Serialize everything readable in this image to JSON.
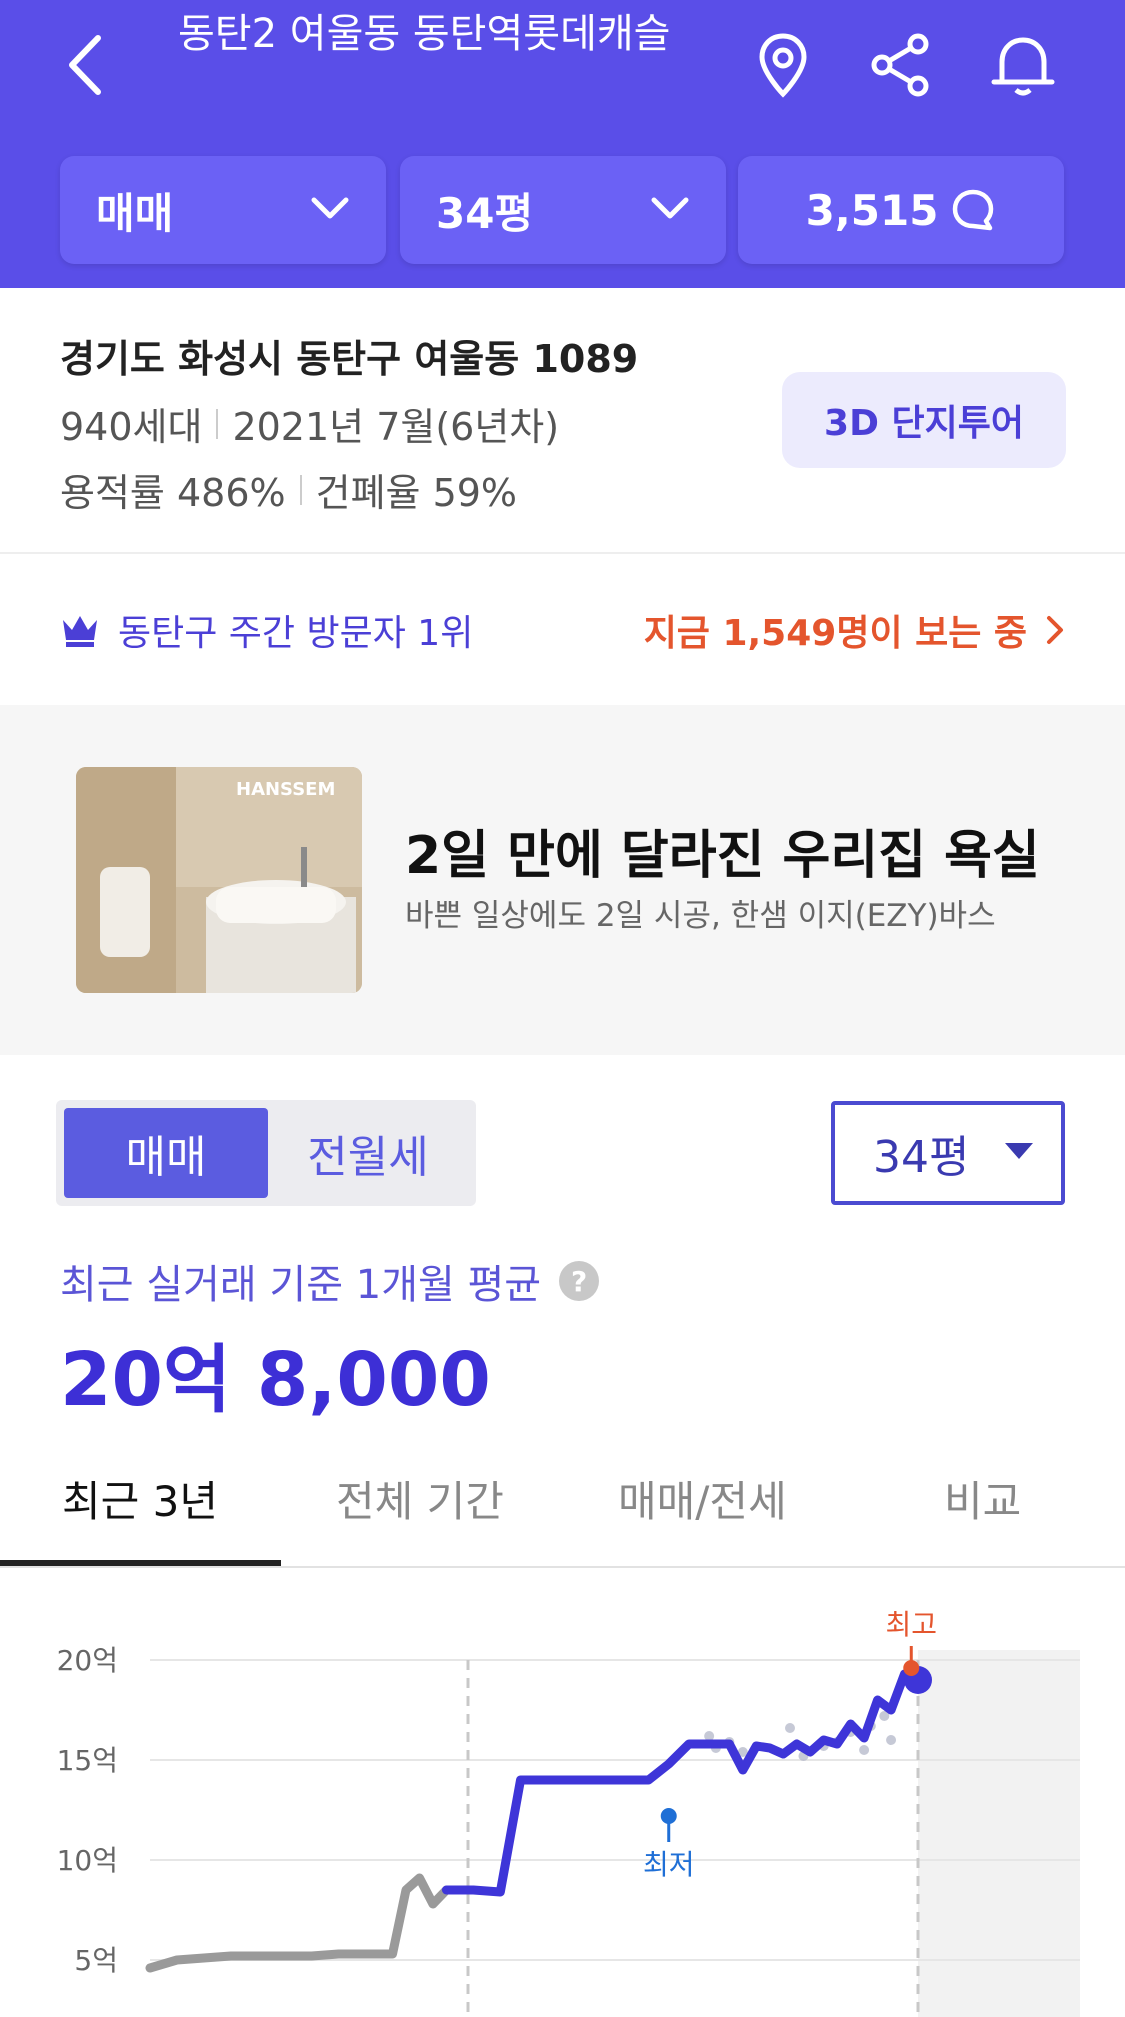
{
  "header": {
    "title": "동탄2 여울동 동탄역롯데캐슬",
    "filters": {
      "deal_type": "매매",
      "area": "34평",
      "comments": "3,515"
    }
  },
  "info": {
    "address": "경기도 화성시 동탄구 여울동 1089",
    "households": "940세대",
    "built": "2021년 7월(6년차)",
    "floor_area_ratio": "용적률 486%",
    "building_coverage": "건폐율 59%",
    "tour_button": "3D 단지투어"
  },
  "rank": {
    "text": "동탄구 주간 방문자 1위",
    "viewers": "지금 1,549명이 보는 중"
  },
  "ad": {
    "brand": "HANSSEM",
    "title": "2일 만에 달라진 우리집 욕실",
    "subtitle": "바쁜 일상에도 2일 시공, 한샘 이지(EZY)바스"
  },
  "price_section": {
    "segment_selected": "매매",
    "segment_other": "전월세",
    "area_select": "34평",
    "avg_label": "최근 실거래 기준 1개월 평균",
    "avg_value": "20억 8,000"
  },
  "tabs": [
    "최근 3년",
    "전체 기간",
    "매매/전세",
    "비교"
  ],
  "colors": {
    "brand": "#5a4ee8",
    "accent": "#3d2fd6",
    "highlight": "#e4552d"
  },
  "chart_data": {
    "type": "line",
    "yticks": [
      "20억",
      "15억",
      "10억",
      "5억"
    ],
    "ylim": [
      4,
      21
    ],
    "series": [
      {
        "x": [
          0,
          4,
          8,
          12,
          16,
          20,
          24,
          28,
          32,
          36,
          38,
          40,
          42,
          44
        ],
        "values": [
          4.6,
          5.0,
          5.1,
          5.2,
          5.2,
          5.2,
          5.2,
          5.3,
          5.3,
          5.3,
          8.5,
          9.1,
          7.8,
          8.5
        ]
      },
      {
        "x": [
          44,
          48,
          52,
          55,
          58,
          62,
          66,
          70,
          74,
          77,
          80,
          82,
          84,
          86,
          88,
          90,
          92,
          94,
          96,
          98,
          100,
          102,
          104,
          106,
          108,
          110,
          112,
          114
        ],
        "values": [
          8.5,
          8.5,
          8.4,
          14.0,
          14.0,
          14.0,
          14.0,
          14.0,
          14.0,
          14.8,
          15.8,
          15.8,
          15.8,
          15.8,
          14.5,
          15.7,
          15.6,
          15.3,
          15.8,
          15.4,
          16.0,
          15.8,
          16.8,
          16.1,
          18.0,
          17.5,
          19.3,
          19.0
        ]
      }
    ],
    "annotations": [
      {
        "label": "최고",
        "x": 113,
        "y": 19.3
      },
      {
        "label": "최저",
        "x": 77,
        "y": 12.2
      }
    ]
  }
}
